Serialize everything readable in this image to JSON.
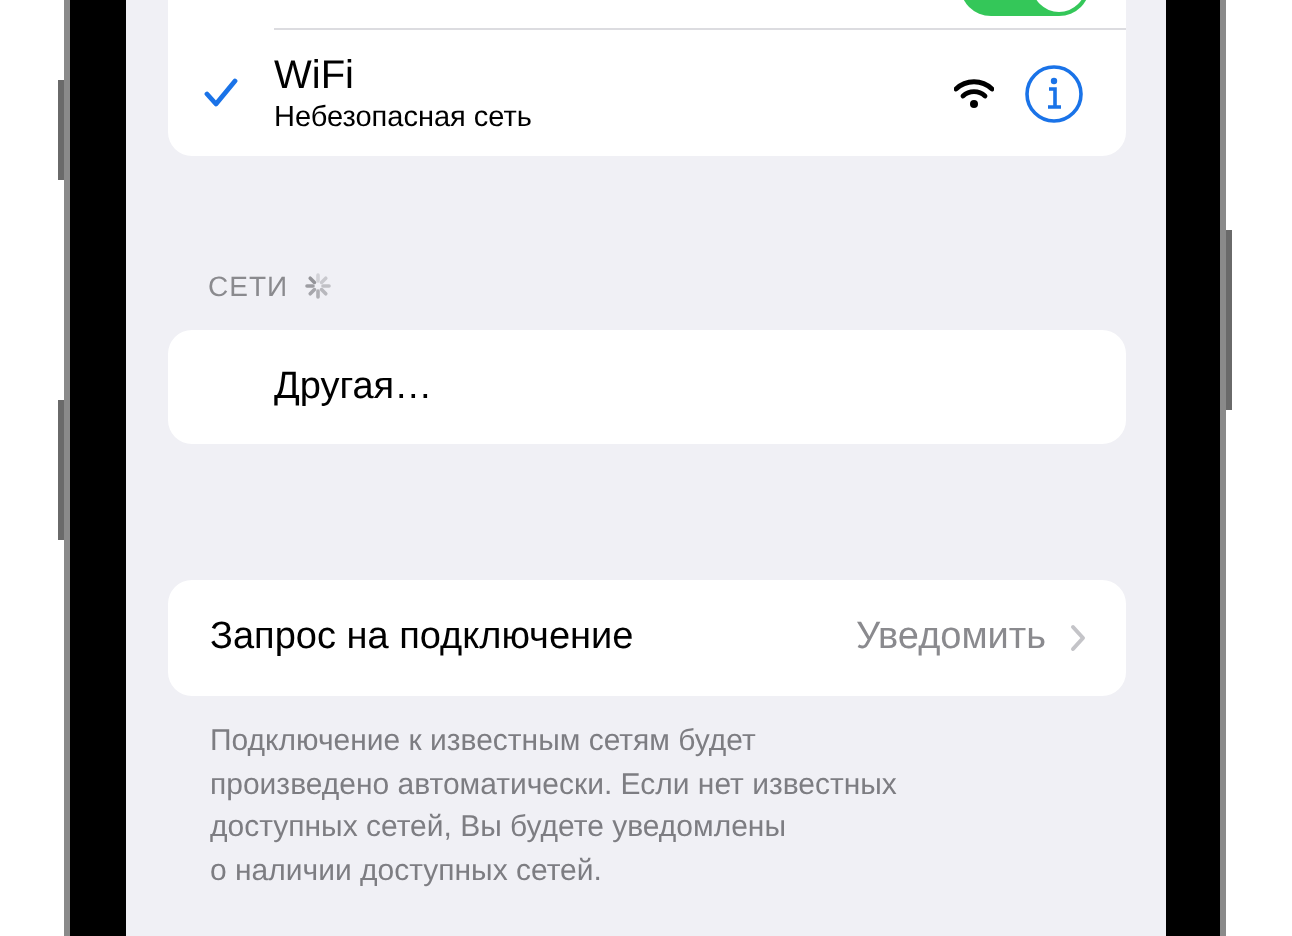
{
  "top_row": {
    "toggle": {
      "on": true
    }
  },
  "current_network": {
    "checked": true,
    "name": "WiFi",
    "subtitle": "Небезопасная сеть"
  },
  "networks_section": {
    "header": "СЕТИ",
    "loading": true,
    "items": [
      {
        "label": "Другая…"
      }
    ]
  },
  "ask_to_join": {
    "label": "Запрос на подключение",
    "value": "Уведомить"
  },
  "footer": "Подключение к известным сетям будет\nпроизведено автоматически. Если нет известных\nдоступных сетей, Вы будете уведомлены\nо наличии доступных сетей."
}
